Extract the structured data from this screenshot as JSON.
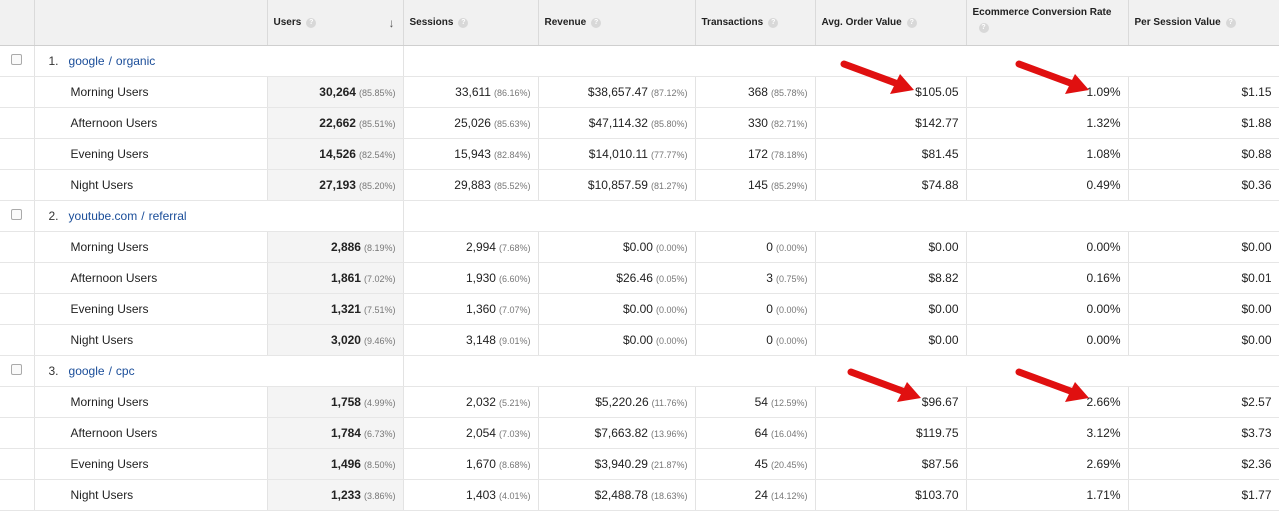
{
  "columns": {
    "users": "Users",
    "sessions": "Sessions",
    "revenue": "Revenue",
    "transactions": "Transactions",
    "aov": "Avg. Order Value",
    "ecr": "Ecommerce Conversion Rate",
    "psv": "Per Session Value",
    "help": "?",
    "sort": "↓"
  },
  "groups": [
    {
      "index": "1.",
      "source": "google",
      "medium": "organic",
      "separator": "/",
      "rows": [
        {
          "label": "Morning Users",
          "users": "30,264",
          "users_pct": "(85.85%)",
          "sessions": "33,611",
          "sessions_pct": "(86.16%)",
          "revenue": "$38,657.47",
          "revenue_pct": "(87.12%)",
          "transactions": "368",
          "transactions_pct": "(85.78%)",
          "aov": "$105.05",
          "ecr": "1.09%",
          "psv": "$1.15"
        },
        {
          "label": "Afternoon Users",
          "users": "22,662",
          "users_pct": "(85.51%)",
          "sessions": "25,026",
          "sessions_pct": "(85.63%)",
          "revenue": "$47,114.32",
          "revenue_pct": "(85.80%)",
          "transactions": "330",
          "transactions_pct": "(82.71%)",
          "aov": "$142.77",
          "ecr": "1.32%",
          "psv": "$1.88"
        },
        {
          "label": "Evening Users",
          "users": "14,526",
          "users_pct": "(82.54%)",
          "sessions": "15,943",
          "sessions_pct": "(82.84%)",
          "revenue": "$14,010.11",
          "revenue_pct": "(77.77%)",
          "transactions": "172",
          "transactions_pct": "(78.18%)",
          "aov": "$81.45",
          "ecr": "1.08%",
          "psv": "$0.88"
        },
        {
          "label": "Night Users",
          "users": "27,193",
          "users_pct": "(85.20%)",
          "sessions": "29,883",
          "sessions_pct": "(85.52%)",
          "revenue": "$10,857.59",
          "revenue_pct": "(81.27%)",
          "transactions": "145",
          "transactions_pct": "(85.29%)",
          "aov": "$74.88",
          "ecr": "0.49%",
          "psv": "$0.36"
        }
      ]
    },
    {
      "index": "2.",
      "source": "youtube.com",
      "medium": "referral",
      "separator": "/",
      "rows": [
        {
          "label": "Morning Users",
          "users": "2,886",
          "users_pct": "(8.19%)",
          "sessions": "2,994",
          "sessions_pct": "(7.68%)",
          "revenue": "$0.00",
          "revenue_pct": "(0.00%)",
          "transactions": "0",
          "transactions_pct": "(0.00%)",
          "aov": "$0.00",
          "ecr": "0.00%",
          "psv": "$0.00"
        },
        {
          "label": "Afternoon Users",
          "users": "1,861",
          "users_pct": "(7.02%)",
          "sessions": "1,930",
          "sessions_pct": "(6.60%)",
          "revenue": "$26.46",
          "revenue_pct": "(0.05%)",
          "transactions": "3",
          "transactions_pct": "(0.75%)",
          "aov": "$8.82",
          "ecr": "0.16%",
          "psv": "$0.01"
        },
        {
          "label": "Evening Users",
          "users": "1,321",
          "users_pct": "(7.51%)",
          "sessions": "1,360",
          "sessions_pct": "(7.07%)",
          "revenue": "$0.00",
          "revenue_pct": "(0.00%)",
          "transactions": "0",
          "transactions_pct": "(0.00%)",
          "aov": "$0.00",
          "ecr": "0.00%",
          "psv": "$0.00"
        },
        {
          "label": "Night Users",
          "users": "3,020",
          "users_pct": "(9.46%)",
          "sessions": "3,148",
          "sessions_pct": "(9.01%)",
          "revenue": "$0.00",
          "revenue_pct": "(0.00%)",
          "transactions": "0",
          "transactions_pct": "(0.00%)",
          "aov": "$0.00",
          "ecr": "0.00%",
          "psv": "$0.00"
        }
      ]
    },
    {
      "index": "3.",
      "source": "google",
      "medium": "cpc",
      "separator": "/",
      "rows": [
        {
          "label": "Morning Users",
          "users": "1,758",
          "users_pct": "(4.99%)",
          "sessions": "2,032",
          "sessions_pct": "(5.21%)",
          "revenue": "$5,220.26",
          "revenue_pct": "(11.76%)",
          "transactions": "54",
          "transactions_pct": "(12.59%)",
          "aov": "$96.67",
          "ecr": "2.66%",
          "psv": "$2.57"
        },
        {
          "label": "Afternoon Users",
          "users": "1,784",
          "users_pct": "(6.73%)",
          "sessions": "2,054",
          "sessions_pct": "(7.03%)",
          "revenue": "$7,663.82",
          "revenue_pct": "(13.96%)",
          "transactions": "64",
          "transactions_pct": "(16.04%)",
          "aov": "$119.75",
          "ecr": "3.12%",
          "psv": "$3.73"
        },
        {
          "label": "Evening Users",
          "users": "1,496",
          "users_pct": "(8.50%)",
          "sessions": "1,670",
          "sessions_pct": "(8.68%)",
          "revenue": "$3,940.29",
          "revenue_pct": "(21.87%)",
          "transactions": "45",
          "transactions_pct": "(20.45%)",
          "aov": "$87.56",
          "ecr": "2.69%",
          "psv": "$2.36"
        },
        {
          "label": "Night Users",
          "users": "1,233",
          "users_pct": "(3.86%)",
          "sessions": "1,403",
          "sessions_pct": "(4.01%)",
          "revenue": "$2,488.78",
          "revenue_pct": "(18.63%)",
          "transactions": "24",
          "transactions_pct": "(14.12%)",
          "aov": "$103.70",
          "ecr": "1.71%",
          "psv": "$1.77"
        }
      ]
    }
  ],
  "annotation_color": "#e01010"
}
